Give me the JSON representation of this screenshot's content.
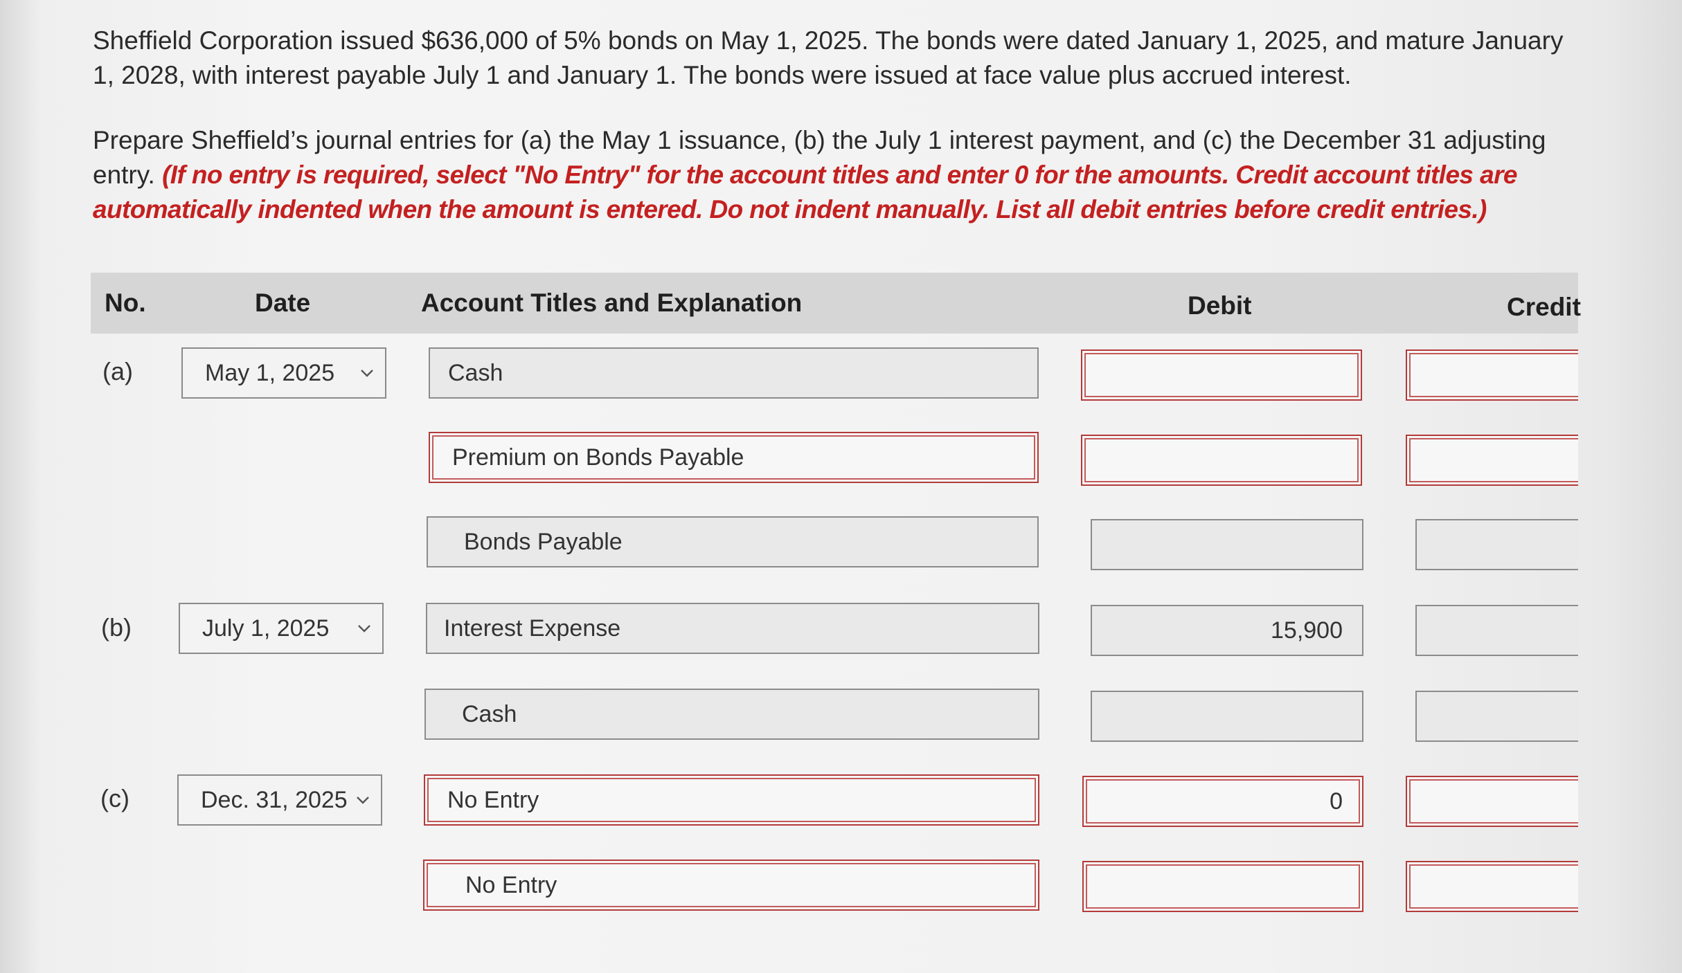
{
  "problem": {
    "paragraph1": "Sheffield Corporation issued $636,000 of 5% bonds on May 1, 2025. The bonds were dated January 1, 2025, and mature January 1, 2028, with interest payable July 1 and January 1. The bonds were issued at face value plus accrued interest.",
    "paragraph2": "Prepare Sheffield’s journal entries for (a) the May 1 issuance, (b) the July 1 interest payment, and (c) the December 31 adjusting entry.",
    "instructions": "(If no entry is required, select \"No Entry\" for the account titles and enter 0 for the amounts. Credit account titles are automatically indented when the amount is entered. Do not indent manually. List all debit entries before credit entries.)"
  },
  "table": {
    "headers": {
      "no": "No.",
      "date": "Date",
      "account": "Account Titles and Explanation",
      "debit": "Debit",
      "credit": "Credit"
    },
    "entries": [
      {
        "label": "(a)",
        "date": "May 1, 2025",
        "lines": [
          {
            "account": "Cash",
            "debit": "",
            "credit": ""
          },
          {
            "account": "Premium on Bonds Payable",
            "debit": "",
            "credit": ""
          },
          {
            "account": "Bonds Payable",
            "debit": "",
            "credit": ""
          }
        ]
      },
      {
        "label": "(b)",
        "date": "July 1, 2025",
        "lines": [
          {
            "account": "Interest Expense",
            "debit": "15,900",
            "credit": ""
          },
          {
            "account": "Cash",
            "debit": "",
            "credit": ""
          }
        ]
      },
      {
        "label": "(c)",
        "date": "Dec. 31, 2025",
        "lines": [
          {
            "account": "No Entry",
            "debit": "0",
            "credit": ""
          },
          {
            "account": "No Entry",
            "debit": "",
            "credit": ""
          }
        ]
      }
    ]
  },
  "icons": {
    "dropdown": "chevron-down-icon"
  },
  "colors": {
    "instruction_text": "#c42020",
    "error_border": "#b33a3a",
    "header_background": "#d6d6d6"
  }
}
